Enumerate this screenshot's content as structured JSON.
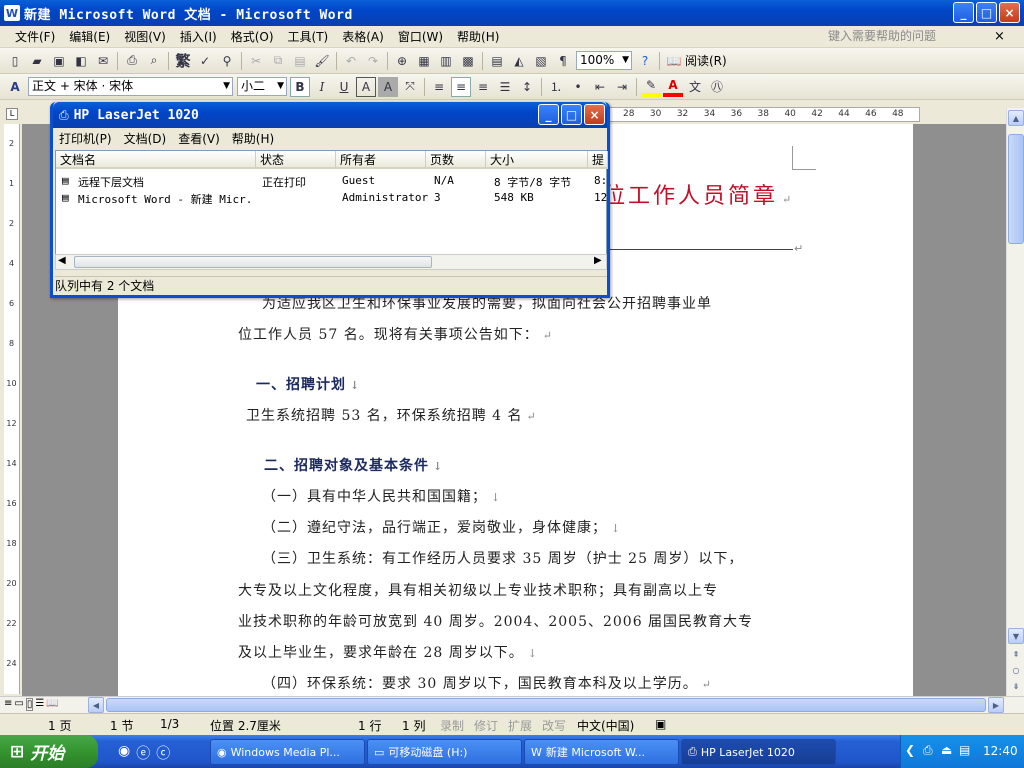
{
  "window": {
    "title": "新建 Microsoft Word 文档 - Microsoft Word",
    "app_icon": "W",
    "min": "_",
    "max": "□",
    "close": "×"
  },
  "menu": [
    "文件(F)",
    "编辑(E)",
    "视图(V)",
    "插入(I)",
    "格式(O)",
    "工具(T)",
    "表格(A)",
    "窗口(W)",
    "帮助(H)"
  ],
  "help_box": {
    "placeholder": "键入需要帮助的问题",
    "close": "×"
  },
  "toolbar": {
    "zoom": "100%",
    "read_label": "阅读(R)",
    "trad_label": "繁"
  },
  "format_bar": {
    "style": "正文 + 宋体 · 宋体",
    "font": "",
    "size": "小二",
    "bold": "B",
    "italic": "I",
    "underline": "U",
    "fontcolor": "A",
    "highlight_colors": {
      "highlight": "#ffff00",
      "font": "#ff0000"
    }
  },
  "ruler": {
    "marks": [
      "28",
      "30",
      "32",
      "34",
      "36",
      "38",
      "40",
      "42",
      "44",
      "46",
      "48"
    ],
    "left_marks": [
      "2",
      "1",
      "2",
      "4",
      "6",
      "8",
      "10",
      "12",
      "14",
      "16",
      "18",
      "20",
      "22",
      "24"
    ]
  },
  "document": {
    "title_partial": "位工作人员简章",
    "p1_line1": "为适应我区卫生和环保事业发展的需要，拟面向社会公开招聘事业单",
    "p1_line2": "位工作人员 57 名。现将有关事项公告如下：",
    "h1": "一、招聘计划",
    "p2": "卫生系统招聘 53 名，环保系统招聘 4 名",
    "h2": "二、招聘对象及基本条件",
    "c1": "（一）具有中华人民共和国国籍；",
    "c2": "（二）遵纪守法，品行端正，爱岗敬业，身体健康；",
    "c3_l1": "（三）卫生系统：有工作经历人员要求 35 周岁（护士 25 周岁）以下，",
    "c3_l2": "大专及以上文化程度，具有相关初级以上专业技术职称；具有副高以上专",
    "c3_l3": "业技术职称的年龄可放宽到 40 周岁。2004、2005、2006 届国民教育大专",
    "c3_l4": "及以上毕业生，要求年龄在 28 周岁以下。",
    "c4": "（四）环保系统：要求 30 周岁以下，国民教育本科及以上学历。",
    "para_mark": "↵",
    "arrow_mark": "↓"
  },
  "dialog": {
    "title": "HP LaserJet 1020",
    "menu": [
      "打印机(P)",
      "文档(D)",
      "查看(V)",
      "帮助(H)"
    ],
    "columns": [
      "文档名",
      "状态",
      "所有者",
      "页数",
      "大小",
      "提"
    ],
    "rows": [
      {
        "name": "远程下层文档",
        "status": "正在打印",
        "owner": "Guest",
        "pages": "N/A",
        "size": "8 字节/8 字节",
        "sub": "8:"
      },
      {
        "name": "Microsoft Word - 新建 Micr...",
        "status": "",
        "owner": "Administrator",
        "pages": "3",
        "size": "548 KB",
        "sub": "12"
      }
    ],
    "status": "队列中有 2 个文档"
  },
  "status_bar": {
    "page": "1 页",
    "section": "1 节",
    "pages": "1/3",
    "position": "位置 2.7厘米",
    "line": "1 行",
    "col": "1 列",
    "rec": "录制",
    "trk": "修订",
    "ext": "扩展",
    "ovr": "改写",
    "lang": "中文(中国)"
  },
  "taskbar": {
    "start": "开始",
    "tasks": [
      "Windows Media Pl...",
      "可移动磁盘 (H:)",
      "新建 Microsoft W...",
      "HP LaserJet 1020"
    ],
    "clock": "12:40"
  }
}
